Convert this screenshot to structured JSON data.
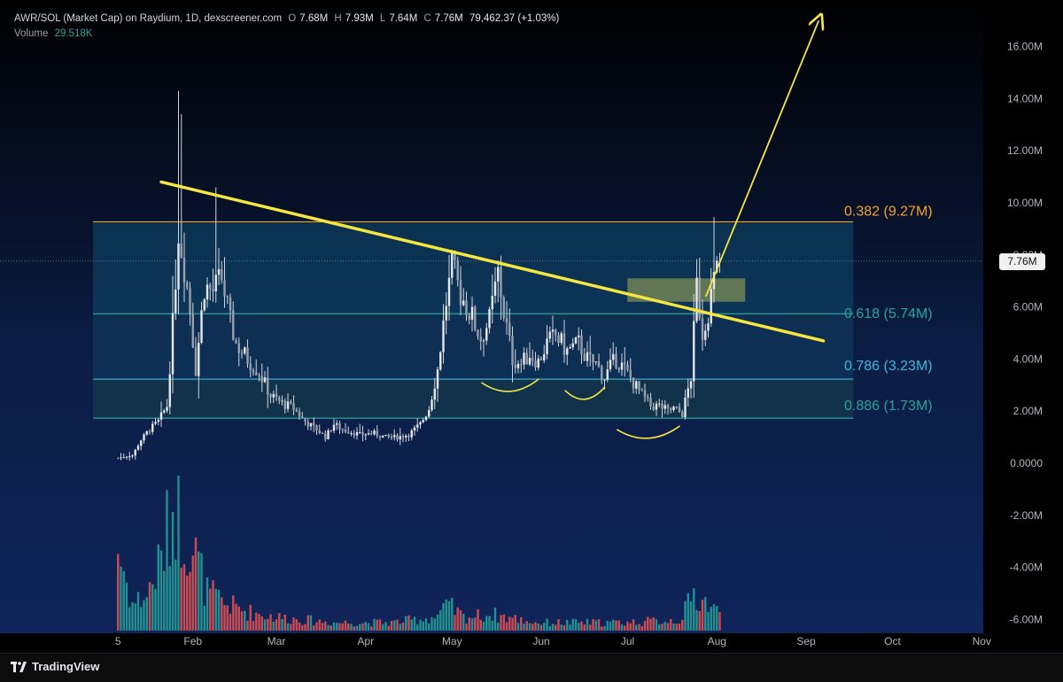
{
  "header": {
    "symbol": "AWR/SOL (Market Cap) on Raydium, 1D, dexscreener.com",
    "o_label": "O",
    "o_value": "7.68M",
    "h_label": "H",
    "h_value": "7.93M",
    "l_label": "L",
    "l_value": "7.64M",
    "c_label": "C",
    "c_value": "7.76M",
    "change": "79,462.37 (+1.03%)",
    "volume_label": "Volume",
    "volume_value": "29.518K"
  },
  "last_price_label": "7.76M",
  "brand": "TradingView",
  "colors": {
    "background": "#000000",
    "candle": "#d1d4dc",
    "trend_line": "#f5e642",
    "fib_0382": "#f5a12a",
    "fib_0618": "#26a69a",
    "fib_0786": "#3fb8d8",
    "fib_0886": "#26a69a",
    "zone_fill": "#7d8d55",
    "volume_up": "#26a69a",
    "volume_down": "#ef5350",
    "axis_text": "#b2b5be"
  },
  "chart_data": {
    "type": "candlestick",
    "y_axis": {
      "ticks": [
        "16.00M",
        "14.00M",
        "12.00M",
        "10.00M",
        "8.00M",
        "6.00M",
        "4.00M",
        "2.00M",
        "0.0000",
        "-2.00M",
        "-4.00M",
        "-6.00M"
      ],
      "tick_values": [
        16,
        14,
        12,
        10,
        8,
        6,
        4,
        2,
        0,
        -2,
        -4,
        -6
      ],
      "range": [
        -6.5,
        17.5
      ],
      "unit": "M"
    },
    "x_axis": {
      "ticks": [
        "5",
        "Feb",
        "Mar",
        "Apr",
        "May",
        "Jun",
        "Jul",
        "Aug",
        "Sep",
        "Oct",
        "Nov"
      ],
      "tick_days": [
        5,
        31,
        60,
        91,
        121,
        152,
        182,
        213,
        244,
        274,
        305
      ]
    },
    "fib_levels": [
      {
        "label": "0.382 (9.27M)",
        "value": 9.27,
        "color": "#f5a12a"
      },
      {
        "label": "0.618 (5.74M)",
        "value": 5.74,
        "color": "#26a69a"
      },
      {
        "label": "0.786 (3.23M)",
        "value": 3.23,
        "color": "#3fb8d8"
      },
      {
        "label": "0.886 (1.73M)",
        "value": 1.73,
        "color": "#26a69a"
      }
    ],
    "fib_range_days": [
      0,
      245
    ],
    "close_anchors": [
      [
        5,
        0.2
      ],
      [
        10,
        0.3
      ],
      [
        13,
        0.9
      ],
      [
        16,
        1.3
      ],
      [
        19,
        1.6
      ],
      [
        22,
        2.2
      ],
      [
        24,
        5.3
      ],
      [
        26,
        9.0
      ],
      [
        28,
        7.6
      ],
      [
        30,
        5.9
      ],
      [
        32,
        3.6
      ],
      [
        35,
        6.8
      ],
      [
        38,
        6.6
      ],
      [
        41,
        7.1
      ],
      [
        44,
        5.4
      ],
      [
        46,
        4.6
      ],
      [
        50,
        4.0
      ],
      [
        54,
        3.5
      ],
      [
        58,
        2.6
      ],
      [
        62,
        2.3
      ],
      [
        66,
        2.1
      ],
      [
        70,
        1.6
      ],
      [
        74,
        1.3
      ],
      [
        77,
        1.0
      ],
      [
        80,
        1.5
      ],
      [
        83,
        1.3
      ],
      [
        86,
        1.2
      ],
      [
        89,
        1.1
      ],
      [
        94,
        1.15
      ],
      [
        98,
        1.0
      ],
      [
        102,
        1.0
      ],
      [
        106,
        1.1
      ],
      [
        110,
        1.5
      ],
      [
        113,
        2.1
      ],
      [
        116,
        3.6
      ],
      [
        119,
        6.2
      ],
      [
        121,
        7.5
      ],
      [
        124,
        6.5
      ],
      [
        128,
        5.6
      ],
      [
        131,
        4.8
      ],
      [
        134,
        5.5
      ],
      [
        137,
        7.3
      ],
      [
        139,
        5.8
      ],
      [
        142,
        4.0
      ],
      [
        145,
        3.8
      ],
      [
        148,
        4.2
      ],
      [
        151,
        3.9
      ],
      [
        154,
        4.6
      ],
      [
        157,
        4.9
      ],
      [
        161,
        4.3
      ],
      [
        165,
        4.6
      ],
      [
        168,
        4.0
      ],
      [
        171,
        3.8
      ],
      [
        174,
        3.3
      ],
      [
        176,
        3.7
      ],
      [
        178,
        4.0
      ],
      [
        181,
        3.6
      ],
      [
        184,
        3.1
      ],
      [
        187,
        2.6
      ],
      [
        190,
        2.2
      ],
      [
        193,
        2.2
      ],
      [
        196,
        2.0
      ],
      [
        198,
        2.1
      ],
      [
        201,
        1.9
      ],
      [
        204,
        3.3
      ],
      [
        206,
        6.8
      ],
      [
        208,
        5.0
      ],
      [
        210,
        5.9
      ],
      [
        212,
        7.0
      ],
      [
        214,
        7.76
      ]
    ],
    "volume_anchors": [
      [
        5,
        3.0
      ],
      [
        10,
        1.0
      ],
      [
        15,
        1.3
      ],
      [
        20,
        2.6
      ],
      [
        25,
        5.0
      ],
      [
        27,
        4.0
      ],
      [
        30,
        3.4
      ],
      [
        33,
        2.4
      ],
      [
        36,
        1.4
      ],
      [
        42,
        1.0
      ],
      [
        50,
        0.7
      ],
      [
        60,
        0.5
      ],
      [
        80,
        0.3
      ],
      [
        100,
        0.3
      ],
      [
        115,
        0.5
      ],
      [
        120,
        0.9
      ],
      [
        125,
        0.5
      ],
      [
        135,
        0.6
      ],
      [
        150,
        0.3
      ],
      [
        180,
        0.3
      ],
      [
        200,
        0.4
      ],
      [
        205,
        1.3
      ],
      [
        210,
        1.0
      ],
      [
        214,
        0.6
      ]
    ],
    "volume_unit": "K",
    "trend_line": [
      [
        20,
        10.8
      ],
      [
        250,
        4.7
      ]
    ],
    "resistance_zone": {
      "days": [
        205,
        245
      ],
      "y": [
        6.2,
        7.1
      ]
    },
    "projection_arrow": [
      [
        215,
        6.4
      ],
      [
        245,
        17.0
      ]
    ],
    "bottom_arcs": [
      {
        "days": [
          138,
          157
        ],
        "y": 3.1
      },
      {
        "days": [
          167,
          180
        ],
        "y": 2.8
      },
      {
        "days": [
          185,
          206
        ],
        "y": 1.3
      }
    ],
    "last_price": 7.76
  }
}
